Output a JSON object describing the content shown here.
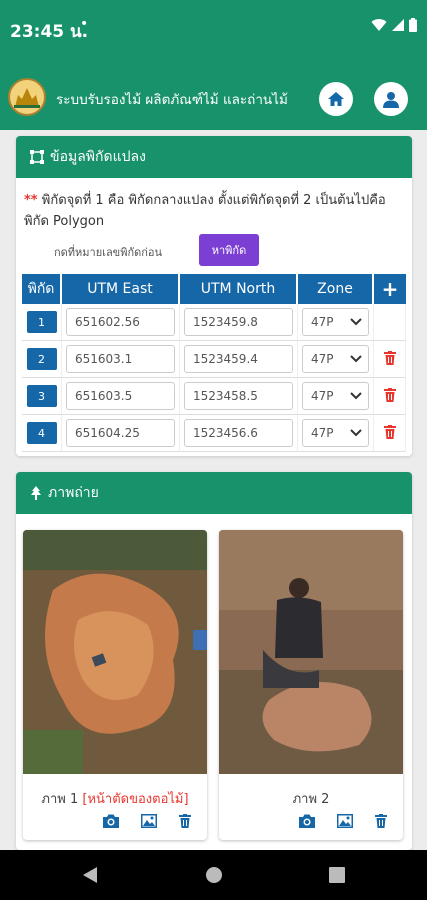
{
  "status_bar": {
    "time": "23:45 น.",
    "dot": "•"
  },
  "app_bar": {
    "title": "ระบบรับรองไม้ ผลิตภัณฑ์ไม้ และถ่านไม้",
    "logo_icon": "emblem-icon",
    "home_icon": "home-icon",
    "profile_icon": "user-icon"
  },
  "coords_card": {
    "title": "ข้อมูลพิกัดแปลง",
    "note_stars": "**",
    "note": "พิกัดจุดที่ 1 คือ พิกัดกลางแปลง ตั้งแต่พิกัดจุดที่ 2 เป็นต้นไปคือพิกัด Polygon",
    "hint": "กดที่หมายเลขพิกัดก่อน",
    "find_label": "หาพิกัด",
    "headers": [
      "พิกัด",
      "UTM East",
      "UTM North",
      "Zone",
      "+"
    ],
    "rows": [
      {
        "num": "1",
        "east": "651602.56",
        "north": "1523459.8",
        "zone": "47P",
        "deletable": false
      },
      {
        "num": "2",
        "east": "651603.1",
        "north": "1523459.4",
        "zone": "47P",
        "deletable": true
      },
      {
        "num": "3",
        "east": "651603.5",
        "north": "1523458.5",
        "zone": "47P",
        "deletable": true
      },
      {
        "num": "4",
        "east": "651604.25",
        "north": "1523456.6",
        "zone": "47P",
        "deletable": true
      }
    ]
  },
  "photo_card": {
    "title": "ภาพถ่าย",
    "photos": [
      {
        "caption": "ภาพ 1",
        "caption_note": "[หน้าตัดของตอไม้]"
      },
      {
        "caption": "ภาพ 2",
        "caption_note": ""
      }
    ]
  },
  "colors": {
    "primary": "#17926a",
    "table_header": "#1567a8",
    "find_button": "#7b3fd3",
    "danger": "#e8372f"
  }
}
